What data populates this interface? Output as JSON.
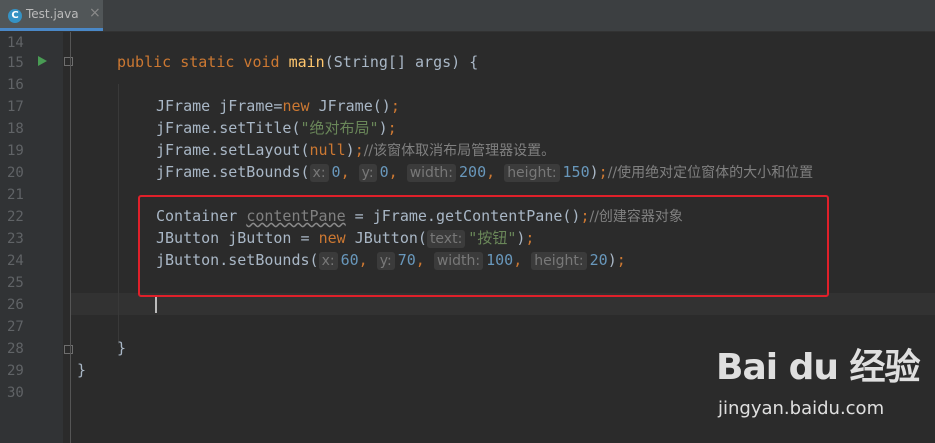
{
  "tab": {
    "filename": "Test.java",
    "icon": "java-class-icon",
    "close": "×"
  },
  "gutter": {
    "line_numbers": [
      "14",
      "15",
      "16",
      "17",
      "18",
      "19",
      "20",
      "21",
      "22",
      "23",
      "24",
      "25",
      "26",
      "27",
      "28",
      "29",
      "30"
    ]
  },
  "code": {
    "l15": {
      "kw1": "public static void ",
      "fn": "main",
      "rest": "(String[] args) {"
    },
    "l17": {
      "t1": "JFrame jFrame=",
      "kw": "new ",
      "t2": "JFrame()",
      "semi": ";"
    },
    "l18": {
      "t1": "jFrame.setTitle(",
      "str": "\"绝对布局\"",
      "t2": ")",
      "semi": ";"
    },
    "l19": {
      "t1": "jFrame.setLayout(",
      "kw": "null",
      "t2": ")",
      "semi": ";",
      "cmt": "//该窗体取消布局管理器设置。"
    },
    "l20": {
      "t1": "jFrame.setBounds(",
      "h1": "x:",
      "n1": "0",
      "h2": "y:",
      "n2": "0",
      "h3": "width:",
      "n3": "200",
      "h4": "height:",
      "n4": "150",
      "t2": ")",
      "semi": ";",
      "cmt": "//使用绝对定位窗体的大小和位置"
    },
    "l22": {
      "t1": "Container ",
      "var": "contentPane",
      "t2": " = jFrame.getContentPane()",
      "semi": ";",
      "cmt": "//创建容器对象"
    },
    "l23": {
      "t1": "JButton jButton = ",
      "kw": "new ",
      "t2": "JButton(",
      "h1": "text:",
      "str": "\"按钮\"",
      "t3": ")",
      "semi": ";"
    },
    "l24": {
      "t1": "jButton.setBounds(",
      "h1": "x:",
      "n1": "60",
      "h2": "y:",
      "n2": "70",
      "h3": "width:",
      "n3": "100",
      "h4": "height:",
      "n4": "20",
      "t2": ")",
      "semi": ";"
    },
    "l28": {
      "t1": "}"
    },
    "l29": {
      "t1": "}"
    }
  },
  "watermark": {
    "logo": "Bai du 经验",
    "url": "jingyan.baidu.com"
  }
}
